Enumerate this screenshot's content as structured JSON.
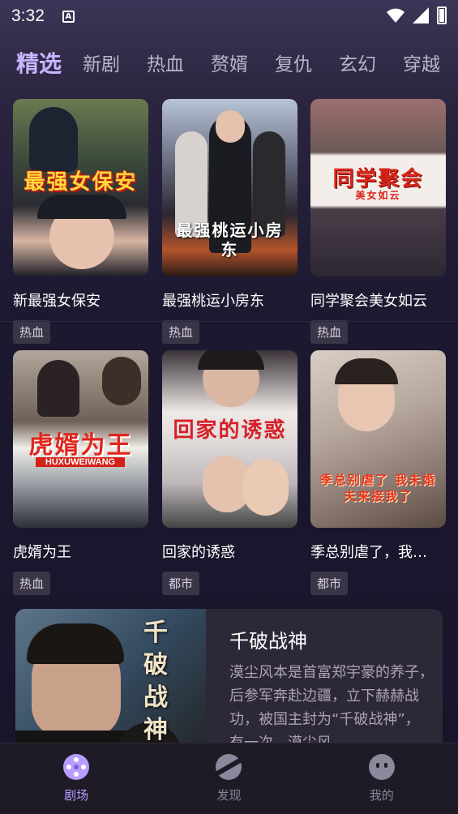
{
  "status": {
    "time": "3:32",
    "notif": "A"
  },
  "tabs": [
    "精选",
    "新剧",
    "热血",
    "赘婿",
    "复仇",
    "玄幻",
    "穿越"
  ],
  "cards": [
    {
      "title": "新最强女保安",
      "tag": "热血",
      "poster_text": "最强女保安"
    },
    {
      "title": "最强桃运小房东",
      "tag": "热血",
      "poster_text": "最强桃运小房东"
    },
    {
      "title": "同学聚会美女如云",
      "tag": "热血",
      "poster_text": "同学聚会",
      "poster_sub": "美女如云"
    },
    {
      "title": "虎婿为王",
      "tag": "热血",
      "poster_text": "虎婿为王",
      "poster_sub": "HUXUWEIWANG"
    },
    {
      "title": "回家的诱惑",
      "tag": "都市",
      "poster_text": "回家的诱惑"
    },
    {
      "title": "季总别虐了，我…",
      "tag": "都市",
      "poster_text": "季总别虐了 我未婚夫来接我了"
    }
  ],
  "feature": {
    "title": "千破战神",
    "desc": "漠尘风本是首富郑宇豪的养子，后参军奔赴边疆，立下赫赫战功，被国主封为“千破战神”，有一次，漠尘风",
    "poster_text": "千破战神"
  },
  "nav": [
    {
      "label": "剧场",
      "icon": "film-reel-icon"
    },
    {
      "label": "发现",
      "icon": "planet-icon"
    },
    {
      "label": "我的",
      "icon": "face-icon"
    }
  ],
  "colors": {
    "accent": "#b89cff",
    "tab_active": "#c9b4ff"
  }
}
